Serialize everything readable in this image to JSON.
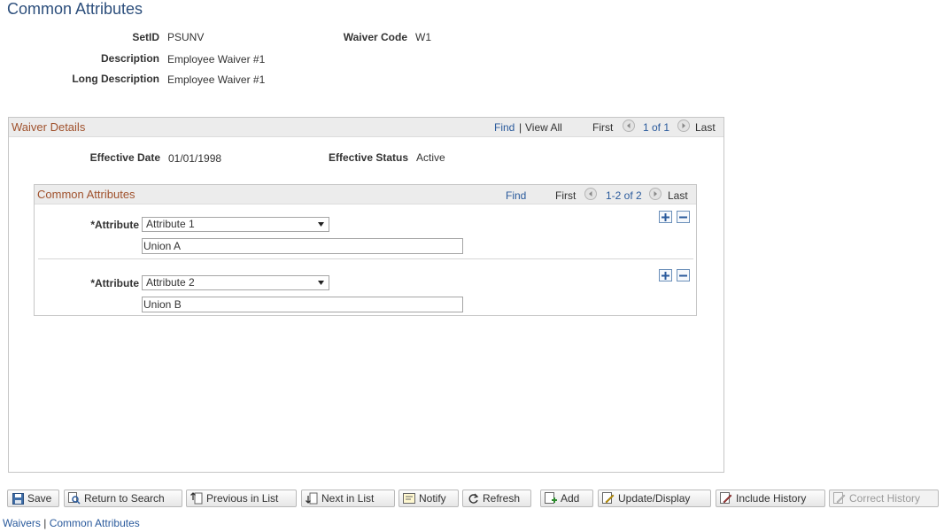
{
  "page": {
    "title": "Common Attributes"
  },
  "header_fields": {
    "setid": {
      "label": "SetID",
      "value": "PSUNV"
    },
    "waiver_code": {
      "label": "Waiver Code",
      "value": "W1"
    },
    "description": {
      "label": "Description",
      "value": "Employee Waiver #1"
    },
    "long_description": {
      "label": "Long Description",
      "value": "Employee Waiver #1"
    }
  },
  "waiver_details": {
    "title": "Waiver Details",
    "nav": {
      "find": "Find",
      "sep": "|",
      "view_all": "View All",
      "first": "First",
      "count": "1 of 1",
      "last": "Last"
    },
    "effective_date": {
      "label": "Effective Date",
      "value": "01/01/1998"
    },
    "effective_status": {
      "label": "Effective Status",
      "value": "Active"
    }
  },
  "common_attributes": {
    "title": "Common Attributes",
    "nav": {
      "find": "Find",
      "first": "First",
      "count": "1-2 of 2",
      "last": "Last"
    },
    "rows": [
      {
        "label": "*Attribute",
        "selected": "Attribute 1",
        "description": "Union A"
      },
      {
        "label": "*Attribute",
        "selected": "Attribute 2",
        "description": "Union B"
      }
    ]
  },
  "toolbar": {
    "save": "Save",
    "return_to_search": "Return to Search",
    "previous_in_list": "Previous in List",
    "next_in_list": "Next in List",
    "notify": "Notify",
    "refresh": "Refresh",
    "add": "Add",
    "update_display": "Update/Display",
    "include_history": "Include History",
    "correct_history": "Correct History"
  },
  "footer": {
    "link1": "Waivers",
    "sep": "|",
    "link2": "Common Attributes"
  },
  "colors": {
    "title": "#2d4f7c",
    "group_title": "#a0522d",
    "link": "#2a5a9c"
  },
  "icons": [
    "floppy-icon",
    "search-return-icon",
    "previous-icon",
    "next-icon",
    "notify-icon",
    "refresh-icon",
    "add-icon",
    "update-icon",
    "history-icon",
    "correct-history-icon",
    "left-arrow-icon",
    "right-arrow-icon",
    "plus-icon",
    "minus-icon",
    "caret-down-icon"
  ]
}
